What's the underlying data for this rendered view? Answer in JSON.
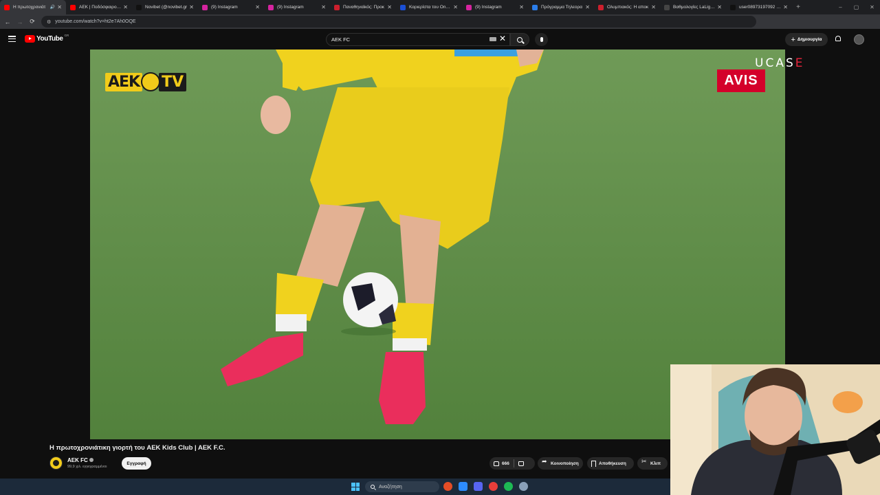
{
  "browser": {
    "tabs": [
      {
        "title": "Η πρωτοχρονιάτ",
        "favicon_color": "#ff0000",
        "active": true,
        "audio": true
      },
      {
        "title": "ΑΕΚ | Ποδόσφαιρο | SP",
        "favicon_color": "#ff0000",
        "active": false
      },
      {
        "title": "Novibet (@novibet.gr",
        "favicon_color": "#111111",
        "active": false
      },
      {
        "title": "(9) Instagram",
        "favicon_color": "#d6249f",
        "active": false
      },
      {
        "title": "(9) Instagram",
        "favicon_color": "#d6249f",
        "active": false
      },
      {
        "title": "Παναθηναϊκός: Προκ",
        "favicon_color": "#cc1f2d",
        "active": false
      },
      {
        "title": "Καριερίστα του OnlyF",
        "favicon_color": "#1a4fd6",
        "active": false
      },
      {
        "title": "(9) Instagram",
        "favicon_color": "#d6249f",
        "active": false
      },
      {
        "title": "Πρόγραμμα Τηλεορα",
        "favicon_color": "#2b7de9",
        "active": false
      },
      {
        "title": "Ολυμπιακός: Η αποκ",
        "favicon_color": "#cc1f2d",
        "active": false
      },
      {
        "title": "Βαθμολογίες LaLiga -",
        "favicon_color": "#444444",
        "active": false
      },
      {
        "title": "user08973197092 (@",
        "favicon_color": "#111111",
        "active": false
      }
    ],
    "new_tab_glyph": "+",
    "window_controls": [
      "–",
      "▢",
      "✕"
    ],
    "url": "youtube.com/watch?v=ht2e7Ah0OQE",
    "extension_colors": [
      "#5a6cf0",
      "#6b5cff",
      "#e8582a",
      "#bbbbbb"
    ]
  },
  "youtube": {
    "logo_text": "YouTube",
    "country_code": "GR",
    "search_query": "AEK FC",
    "create_label": "Δημιουργία"
  },
  "video": {
    "overlay_logo_left": "AEK",
    "overlay_logo_right": "TV",
    "sponsor": "AVIS",
    "stream_logo_main": "UCAS",
    "stream_logo_accent": "E"
  },
  "watch": {
    "title": "Η πρωτοχρονιάτικη γιορτή του AEK Kids Club | AEK F.C.",
    "channel_name": "AEK FC",
    "subscribers": "99,9 χιλ. εγγεγραμμένοι",
    "subscribe_label": "Εγγραφή",
    "likes": "666",
    "share_label": "Κοινοποίηση",
    "save_label": "Αποθήκευση",
    "clip_label": "Κλιπ"
  },
  "taskbar": {
    "search_placeholder": "Αναζήτηση",
    "app_colors": [
      "#e44d26",
      "#2d8cff",
      "#5865f2",
      "#e93e3a",
      "#1db954",
      "#8aa0b8"
    ]
  }
}
